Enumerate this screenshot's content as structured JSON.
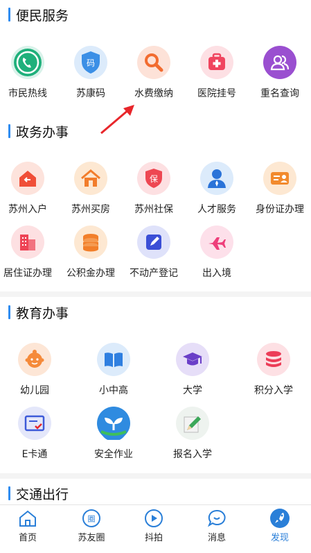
{
  "sections": {
    "citizen": {
      "title": "便民服务",
      "items": [
        {
          "label": "市民热线",
          "icon": "phone-icon"
        },
        {
          "label": "苏康码",
          "icon": "health-code-icon",
          "glyph": "码"
        },
        {
          "label": "水费缴纳",
          "icon": "search-icon"
        },
        {
          "label": "医院挂号",
          "icon": "medical-kit-icon"
        },
        {
          "label": "重名查询",
          "icon": "people-icon"
        }
      ]
    },
    "gov": {
      "title": "政务办事",
      "items": [
        {
          "label": "苏州入户",
          "icon": "house-enter-icon"
        },
        {
          "label": "苏州买房",
          "icon": "house-icon"
        },
        {
          "label": "苏州社保",
          "icon": "shield-icon",
          "glyph": "保"
        },
        {
          "label": "人才服务",
          "icon": "person-icon"
        },
        {
          "label": "身份证办理",
          "icon": "id-card-icon"
        },
        {
          "label": "居住证办理",
          "icon": "building-icon"
        },
        {
          "label": "公积金办理",
          "icon": "coins-icon"
        },
        {
          "label": "不动产登记",
          "icon": "edit-icon"
        },
        {
          "label": "出入境",
          "icon": "airplane-icon"
        }
      ]
    },
    "edu": {
      "title": "教育办事",
      "items": [
        {
          "label": "幼儿园",
          "icon": "baby-icon"
        },
        {
          "label": "小中高",
          "icon": "book-icon"
        },
        {
          "label": "大学",
          "icon": "graduation-cap-icon"
        },
        {
          "label": "积分入学",
          "icon": "stack-icon"
        },
        {
          "label": "E卡通",
          "icon": "card-icon"
        },
        {
          "label": "安全作业",
          "icon": "sprout-icon"
        },
        {
          "label": "报名入学",
          "icon": "pencil-icon"
        }
      ]
    },
    "traffic": {
      "title": "交通出行"
    }
  },
  "tabs": [
    {
      "label": "首页",
      "icon": "home-icon"
    },
    {
      "label": "苏友圈",
      "icon": "circle-icon",
      "glyph": "圈"
    },
    {
      "label": "抖拍",
      "icon": "play-icon"
    },
    {
      "label": "消息",
      "icon": "message-icon"
    },
    {
      "label": "发现",
      "icon": "rocket-icon",
      "active": true
    }
  ],
  "colors": {
    "accent": "#2f8cf0",
    "arrow": "#e8262b"
  }
}
